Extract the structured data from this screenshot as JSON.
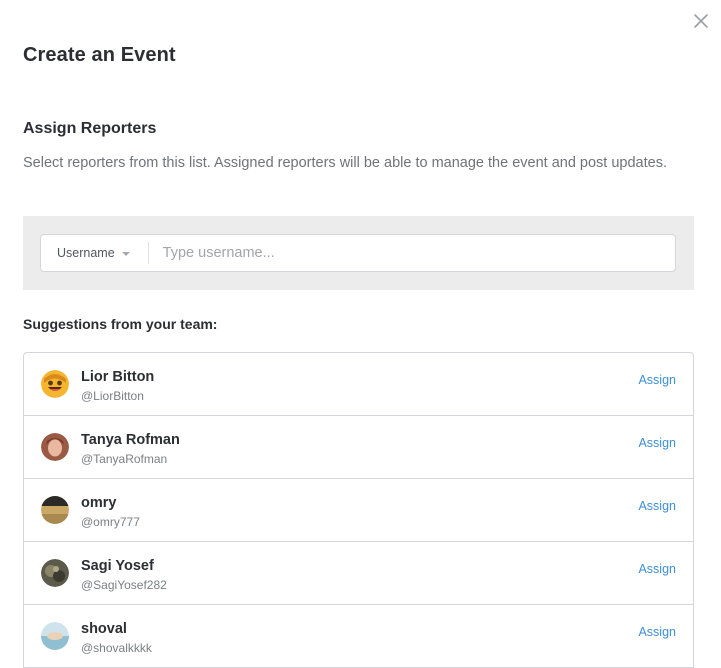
{
  "dialog": {
    "title": "Create an Event",
    "section_title": "Assign Reporters",
    "description": "Select reporters from this list. Assigned reporters will be able to manage the event and post updates."
  },
  "search": {
    "filter_label": "Username",
    "placeholder": "Type username...",
    "value": ""
  },
  "suggestions": {
    "title": "Suggestions from your team:",
    "assign_label": "Assign",
    "items": [
      {
        "name": "Lior Bitton",
        "handle": "@LiorBitton"
      },
      {
        "name": "Tanya Rofman",
        "handle": "@TanyaRofman"
      },
      {
        "name": "omry",
        "handle": "@omry777"
      },
      {
        "name": "Sagi Yosef",
        "handle": "@SagiYosef282"
      },
      {
        "name": "shoval",
        "handle": "@shovalkkkk"
      }
    ]
  },
  "colors": {
    "link": "#3d8fd6",
    "search_band": "#ececec",
    "border": "#d4d6d9"
  },
  "icons": {
    "close": "close-icon",
    "dropdown": "chevron-down-icon"
  }
}
